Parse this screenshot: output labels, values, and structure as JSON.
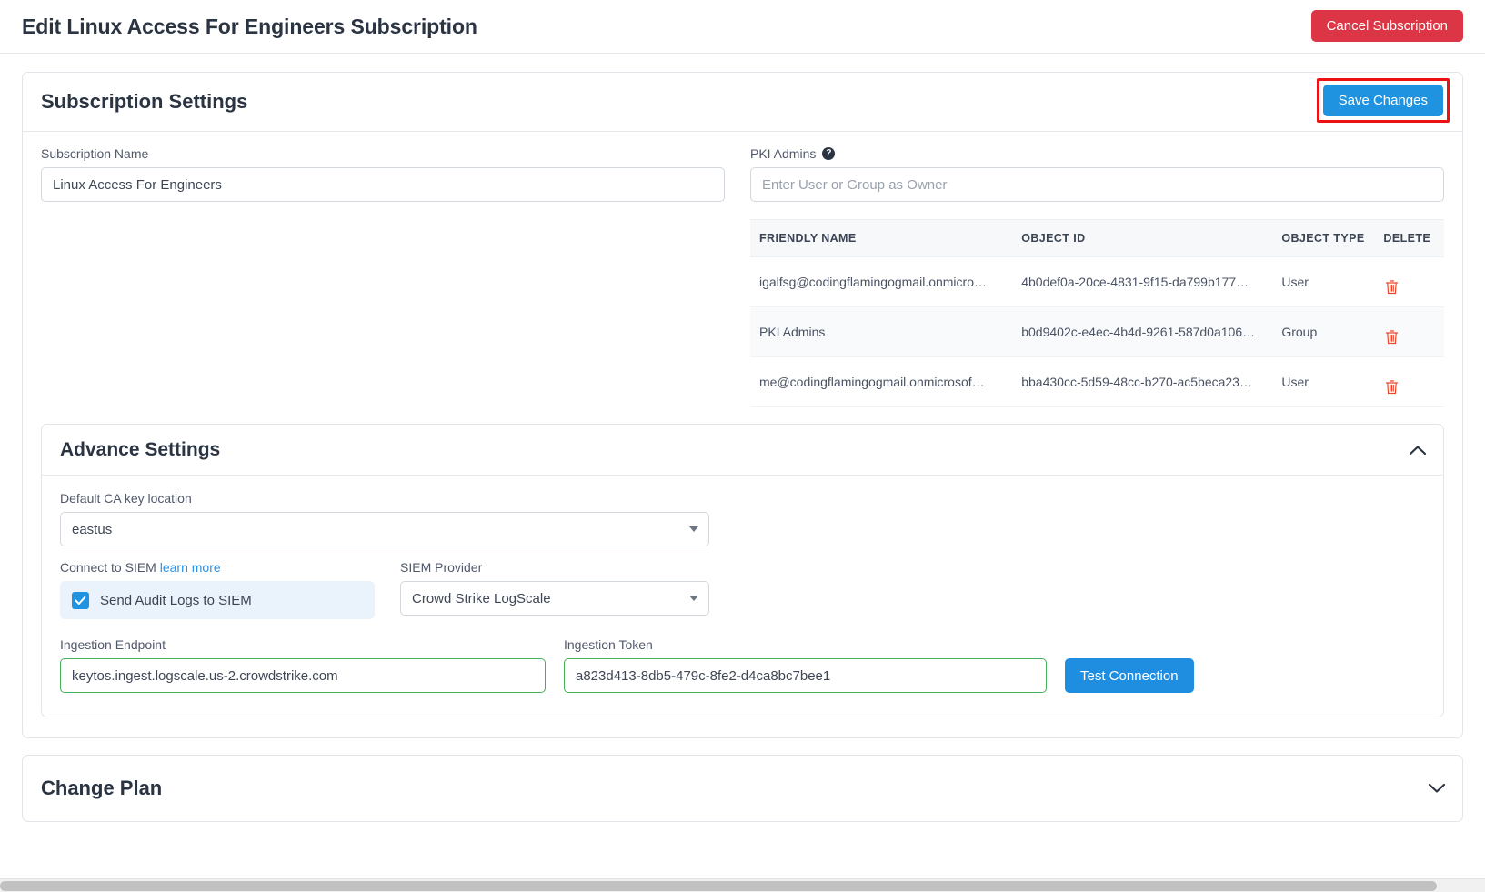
{
  "header": {
    "title": "Edit Linux Access For Engineers Subscription",
    "cancel_label": "Cancel Subscription"
  },
  "subscription_settings": {
    "title": "Subscription Settings",
    "save_label": "Save Changes",
    "name_label": "Subscription Name",
    "name_value": "Linux Access For Engineers",
    "pki_admins_label": "PKI Admins",
    "help_glyph": "?",
    "owner_placeholder": "Enter User or Group as Owner",
    "owner_value": "",
    "table": {
      "columns": [
        "FRIENDLY NAME",
        "OBJECT ID",
        "OBJECT TYPE",
        "DELETE"
      ],
      "rows": [
        {
          "friendly_name": "igalfsg@codingflamingogmail.onmicro…",
          "object_id": "4b0def0a-20ce-4831-9f15-da799b177…",
          "object_type": "User"
        },
        {
          "friendly_name": "PKI Admins",
          "object_id": "b0d9402c-e4ec-4b4d-9261-587d0a106…",
          "object_type": "Group"
        },
        {
          "friendly_name": "me@codingflamingogmail.onmicrosof…",
          "object_id": "bba430cc-5d59-48cc-b270-ac5beca23…",
          "object_type": "User"
        }
      ]
    }
  },
  "advance_settings": {
    "title": "Advance Settings",
    "collapse_icon": "chevron-up-icon",
    "ca_location_label": "Default CA key location",
    "ca_location_value": "eastus",
    "connect_siem_label": "Connect to SIEM",
    "learn_more_label": "learn more",
    "siem_checkbox_label": "Send Audit Logs to SIEM",
    "siem_checkbox_checked": true,
    "siem_provider_label": "SIEM Provider",
    "siem_provider_value": "Crowd Strike LogScale",
    "ingestion_endpoint_label": "Ingestion Endpoint",
    "ingestion_endpoint_value": "keytos.ingest.logscale.us-2.crowdstrike.com",
    "ingestion_token_label": "Ingestion Token",
    "ingestion_token_value": "a823d413-8db5-479c-8fe2-d4ca8bc7bee1",
    "test_connection_label": "Test Connection"
  },
  "change_plan": {
    "title": "Change Plan",
    "expand_icon": "chevron-down-icon"
  },
  "colors": {
    "danger": "#dc3545",
    "primary": "#1f93e0",
    "highlight": "#ee1111",
    "valid_border": "#45b05c",
    "link": "#2f90e0"
  }
}
